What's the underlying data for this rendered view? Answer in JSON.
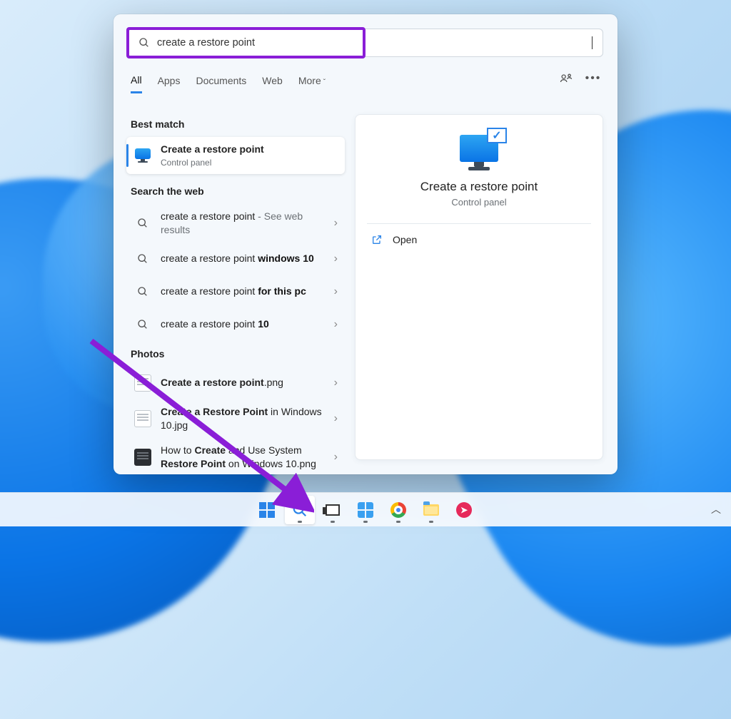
{
  "search": {
    "value": "create a restore point"
  },
  "tabs": {
    "all": "All",
    "apps": "Apps",
    "documents": "Documents",
    "web": "Web",
    "more": "More"
  },
  "sections": {
    "best_match": "Best match",
    "search_web": "Search the web",
    "photos": "Photos"
  },
  "best_match": {
    "title": "Create a restore point",
    "sub": "Control panel"
  },
  "web_results": [
    {
      "prefix": "create a restore point",
      "bold": "",
      "suffix": " - See web results"
    },
    {
      "prefix": "create a restore point ",
      "bold": "windows 10",
      "suffix": ""
    },
    {
      "prefix": "create a restore point ",
      "bold": "for this pc",
      "suffix": ""
    },
    {
      "prefix": "create a restore point ",
      "bold": "10",
      "suffix": ""
    }
  ],
  "photos": [
    {
      "pre": "",
      "bold": "Create a restore point",
      "post": ".png",
      "thumb": "light"
    },
    {
      "pre": "",
      "bold": "Create a Restore Point",
      "post": " in Windows 10.jpg",
      "thumb": "light"
    },
    {
      "pre": "How to ",
      "bold": "Create",
      "post2_pre": " and Use System ",
      "bold2": "Restore Point",
      "post": " on Windows 10.png",
      "thumb": "dark"
    }
  ],
  "preview": {
    "title": "Create a restore point",
    "sub": "Control panel",
    "open": "Open"
  },
  "taskbar": {
    "items": [
      "start",
      "search",
      "taskview",
      "widgets",
      "chrome",
      "explorer",
      "redapp"
    ]
  }
}
